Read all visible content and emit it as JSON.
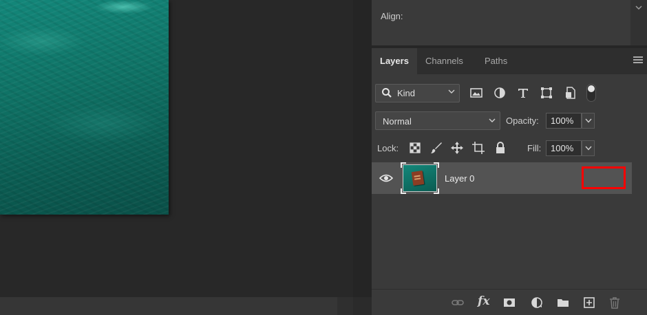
{
  "properties": {
    "align_label": "Align:"
  },
  "layers_panel": {
    "tabs": [
      {
        "label": "Layers",
        "active": true
      },
      {
        "label": "Channels",
        "active": false
      },
      {
        "label": "Paths",
        "active": false
      }
    ],
    "filter": {
      "kind_label": "Kind"
    },
    "blend": {
      "mode": "Normal",
      "opacity_label": "Opacity:",
      "opacity_value": "100%"
    },
    "lock": {
      "label": "Lock:",
      "fill_label": "Fill:",
      "fill_value": "100%"
    },
    "layers": [
      {
        "name": "Layer 0",
        "visible": true,
        "selected": true
      }
    ],
    "bottom_toolbar": {
      "fx_label": "fx"
    }
  },
  "colors": {
    "canvas_teal": "#0f7265",
    "panel_bg": "#3a3a3a",
    "selected_row": "#535353",
    "highlight": "#ff0000"
  }
}
